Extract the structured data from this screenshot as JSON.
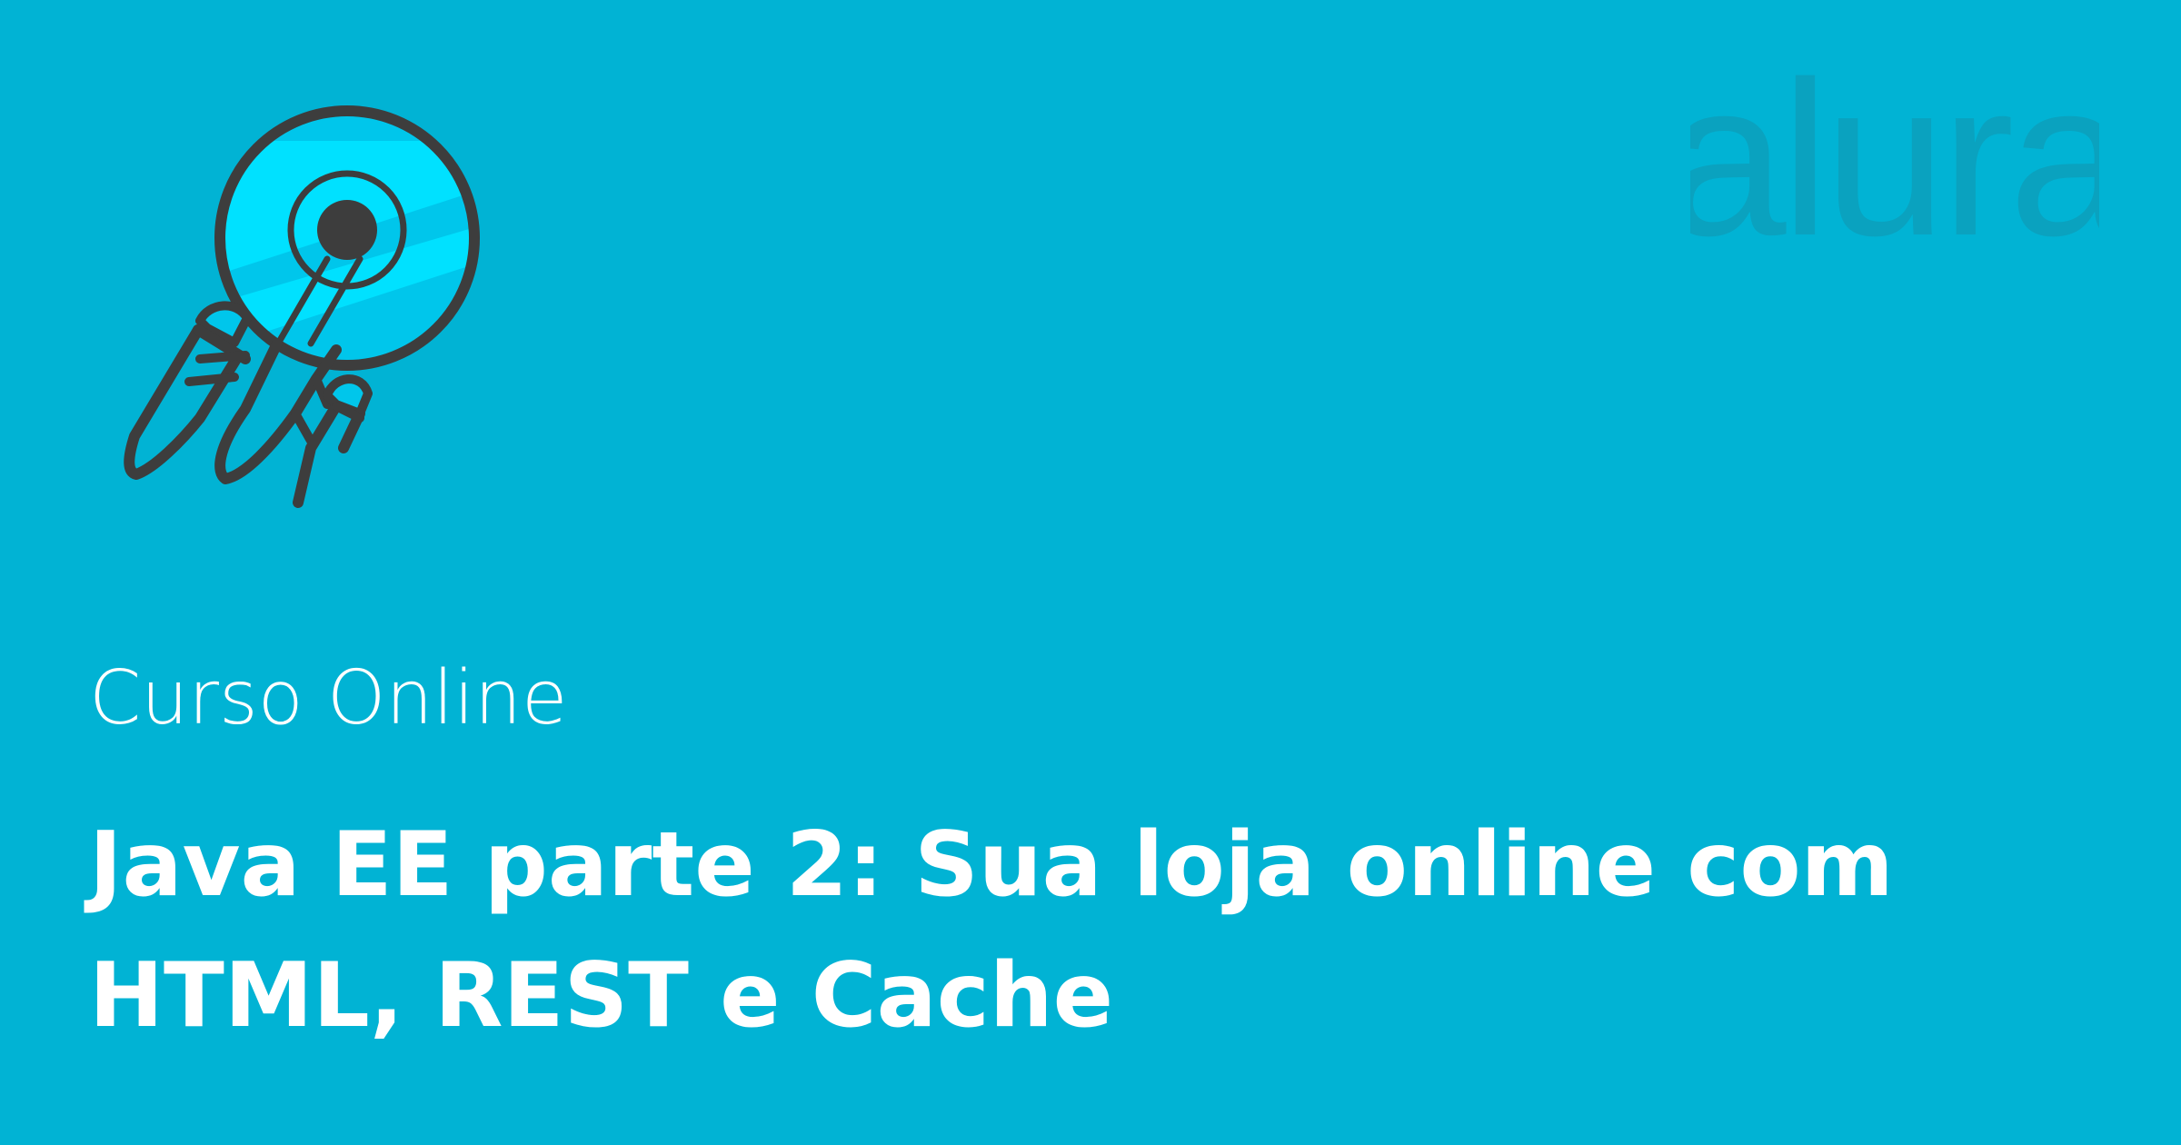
{
  "colors": {
    "background": "#01b3d4",
    "text": "#ffffff",
    "icon_stroke": "#3d3d3d",
    "icon_fill": "#00c6eb",
    "icon_fill_light": "#00e1ff",
    "logo": "#0aa2bf"
  },
  "icon": "rocket-icon",
  "logo": {
    "icon": "alura-logo",
    "text": "alura"
  },
  "subtitle": "Curso Online",
  "title_lines": [
    "Java EE parte 2: Sua loja online com",
    "HTML, REST e Cache"
  ]
}
